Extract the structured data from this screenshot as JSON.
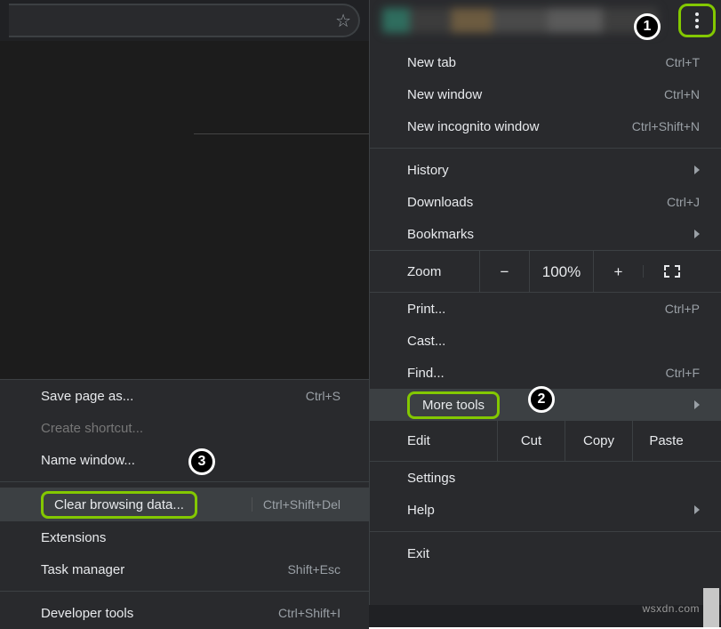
{
  "topbar": {
    "star_icon": "☆"
  },
  "steps": {
    "one": "1",
    "two": "2",
    "three": "3"
  },
  "main_menu": {
    "new_tab": {
      "label": "New tab",
      "shortcut": "Ctrl+T"
    },
    "new_window": {
      "label": "New window",
      "shortcut": "Ctrl+N"
    },
    "new_incognito": {
      "label": "New incognito window",
      "shortcut": "Ctrl+Shift+N"
    },
    "history": {
      "label": "History"
    },
    "downloads": {
      "label": "Downloads",
      "shortcut": "Ctrl+J"
    },
    "bookmarks": {
      "label": "Bookmarks"
    },
    "zoom": {
      "label": "Zoom",
      "minus": "−",
      "value": "100%",
      "plus": "+"
    },
    "print": {
      "label": "Print...",
      "shortcut": "Ctrl+P"
    },
    "cast": {
      "label": "Cast..."
    },
    "find": {
      "label": "Find...",
      "shortcut": "Ctrl+F"
    },
    "more_tools": {
      "label": "More tools"
    },
    "edit": {
      "label": "Edit",
      "cut": "Cut",
      "copy": "Copy",
      "paste": "Paste"
    },
    "settings": {
      "label": "Settings"
    },
    "help": {
      "label": "Help"
    },
    "exit": {
      "label": "Exit"
    }
  },
  "more_tools_menu": {
    "save_page": {
      "label": "Save page as...",
      "shortcut": "Ctrl+S"
    },
    "create_shortcut": {
      "label": "Create shortcut..."
    },
    "name_window": {
      "label": "Name window..."
    },
    "clear_data": {
      "label": "Clear browsing data...",
      "shortcut": "Ctrl+Shift+Del"
    },
    "extensions": {
      "label": "Extensions"
    },
    "task_manager": {
      "label": "Task manager",
      "shortcut": "Shift+Esc"
    },
    "developer_tools": {
      "label": "Developer tools",
      "shortcut": "Ctrl+Shift+I"
    }
  },
  "watermark": "wsxdn.com"
}
